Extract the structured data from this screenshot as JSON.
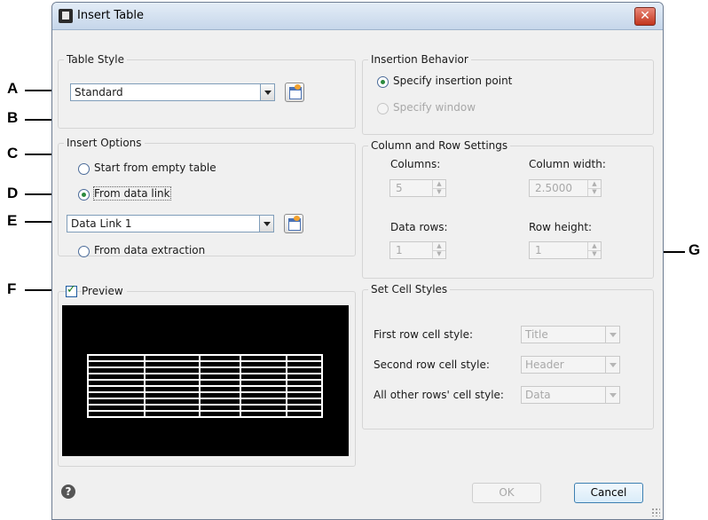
{
  "window": {
    "title": "Insert Table",
    "close_glyph": "✕",
    "icon": "app-icon"
  },
  "callouts": [
    "A",
    "B",
    "C",
    "D",
    "E",
    "F",
    "G"
  ],
  "table_style": {
    "legend": "Table Style",
    "selected": "Standard",
    "button_icon": "table-style-dialog-icon"
  },
  "insert_options": {
    "legend": "Insert Options",
    "radios": [
      {
        "label": "Start from empty table",
        "checked": false
      },
      {
        "label": "From data link",
        "checked": true
      },
      {
        "label": "From data extraction",
        "checked": false
      }
    ],
    "data_link": "Data Link 1",
    "button_icon": "data-link-manager-icon"
  },
  "preview": {
    "label": "Preview",
    "checked": true
  },
  "insertion_behavior": {
    "legend": "Insertion Behavior",
    "radios": [
      {
        "label": "Specify insertion point",
        "checked": true,
        "enabled": true
      },
      {
        "label": "Specify window",
        "checked": false,
        "enabled": false
      }
    ]
  },
  "column_row": {
    "legend": "Column and Row Settings",
    "columns_label": "Columns:",
    "columns_value": "5",
    "column_width_label": "Column width:",
    "column_width_value": "2.5000",
    "data_rows_label": "Data rows:",
    "data_rows_value": "1",
    "row_height_label": "Row height:",
    "row_height_value": "1"
  },
  "cell_styles": {
    "legend": "Set Cell Styles",
    "rows": [
      {
        "label": "First row cell style:",
        "value": "Title"
      },
      {
        "label": "Second row cell style:",
        "value": "Header"
      },
      {
        "label": "All other rows' cell style:",
        "value": "Data"
      }
    ]
  },
  "footer": {
    "help_glyph": "?",
    "ok": "OK",
    "cancel": "Cancel"
  }
}
